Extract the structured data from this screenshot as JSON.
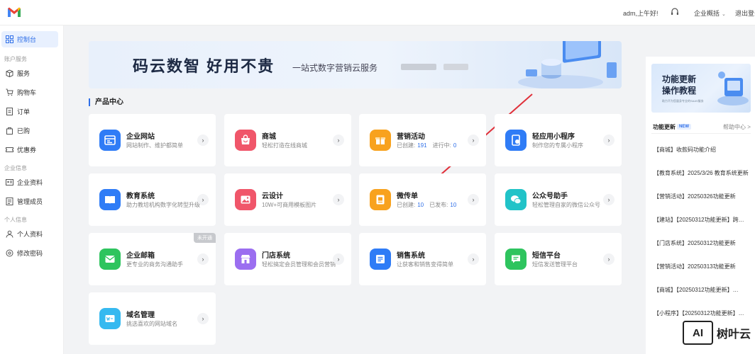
{
  "topbar": {
    "greeting": "adm,上午好!",
    "overview": "企业概括",
    "logout": "退出登录"
  },
  "sidebar": {
    "active": "控制台",
    "sections": [
      {
        "title": "账户服务",
        "items": [
          "服务",
          "购物车",
          "订单",
          "已购",
          "优惠券"
        ]
      },
      {
        "title": "企业信息",
        "items": [
          "企业资料",
          "管理成员"
        ]
      },
      {
        "title": "个人信息",
        "items": [
          "个人资料",
          "修改密码"
        ]
      }
    ]
  },
  "banner": {
    "title": "码云数智  好用不贵",
    "subtitle": "一站式数字营销云服务"
  },
  "section_title": "产品中心",
  "cards": [
    {
      "title": "企业网站",
      "desc": "网站制作、维护都简单",
      "color": "#2f7cf6",
      "icon": "website-icon"
    },
    {
      "title": "商城",
      "desc": "轻松打造在线商城",
      "color": "#f0566a",
      "icon": "shop-icon"
    },
    {
      "title": "营销活动",
      "created_label": "已创建:",
      "created": "191",
      "second_label": "进行中:",
      "second": "0",
      "color": "#f8a21e",
      "icon": "gift-icon"
    },
    {
      "title": "轻应用小程序",
      "desc": "制作您的专属小程序",
      "color": "#2f7cf6",
      "icon": "miniapp-icon"
    },
    {
      "title": "教育系统",
      "desc": "助力教培机构数字化转型升级",
      "color": "#2f7cf6",
      "icon": "book-icon"
    },
    {
      "title": "云设计",
      "desc": "10W+可商用模板图片",
      "color": "#f0566a",
      "icon": "image-icon"
    },
    {
      "title": "微传单",
      "created_label": "已创建:",
      "created": "10",
      "second_label": "已发布:",
      "second": "10",
      "color": "#f8a21e",
      "icon": "flyer-icon"
    },
    {
      "title": "公众号助手",
      "desc": "轻松管理自家的微信公众号",
      "color": "#21c3c8",
      "icon": "wechat-icon"
    },
    {
      "title": "企业邮箱",
      "desc": "更专业的商务沟通助手",
      "color": "#2ec45e",
      "icon": "mail-icon",
      "tag": "未开通"
    },
    {
      "title": "门店系统",
      "desc": "轻松搞定会员管理和会员营销",
      "color": "#9b6ef0",
      "icon": "store-icon"
    },
    {
      "title": "销售系统",
      "desc": "让获客和销售变得简单",
      "color": "#2f7cf6",
      "icon": "list-icon"
    },
    {
      "title": "短信平台",
      "desc": "短信发送管理平台",
      "color": "#2ec45e",
      "icon": "sms-icon"
    },
    {
      "title": "域名管理",
      "desc": "挑选喜欢的网站域名",
      "color": "#36b9f0",
      "icon": "domain-icon"
    }
  ],
  "right_panel": {
    "banner_line1": "功能更新",
    "banner_line2": "操作教程",
    "banner_small": "助力不为您量身专业的SAAS服务",
    "heading": "功能更新",
    "new_badge": "NEW",
    "help": "帮助中心 >",
    "items": [
      "【商城】收款码功能介绍",
      "【教育系统】2025/3/26 教育系统更新",
      "【营销活动】20250326功能更新",
      "【建站】【20250312功能更新】跨…",
      "【门店系统】20250312功能更新",
      "【营销活动】20250313功能更新",
      "【商城】【20250312功能更新】…",
      "【小程序】【20250312功能更新】…"
    ]
  },
  "watermark": {
    "box": "AI",
    "text": "树叶云"
  }
}
